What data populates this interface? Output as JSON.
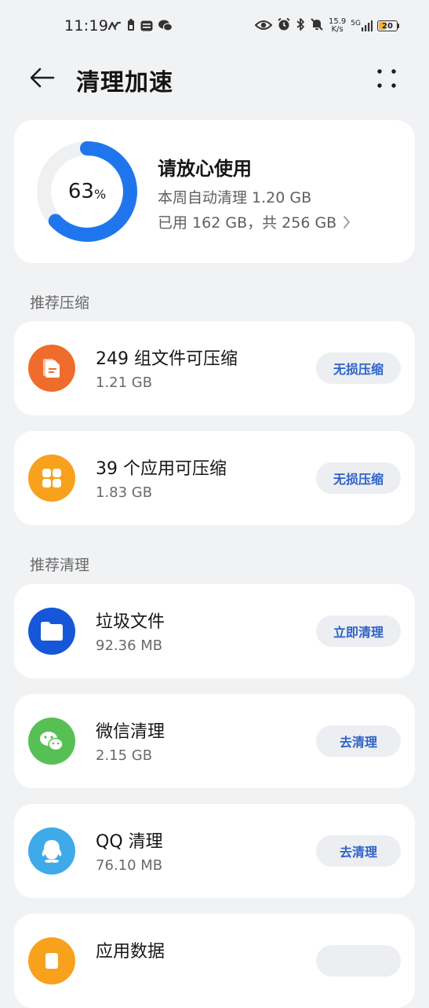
{
  "status_bar": {
    "time": "11:19",
    "net_speed_value": "15.9",
    "net_speed_unit": "K/s",
    "signal": "5G",
    "battery": "20",
    "left_icons": [
      "vpn-icon",
      "battery-saver-icon",
      "message-icon",
      "wechat-icon"
    ],
    "right_icons": [
      "eye-comfort-icon",
      "alarm-icon",
      "bluetooth-icon",
      "mute-icon"
    ]
  },
  "header": {
    "title": "清理加速"
  },
  "summary": {
    "percent": "63",
    "percent_unit": "%",
    "used_fraction": 0.63,
    "status": "请放心使用",
    "weekly_clean": "本周自动清理 1.20 GB",
    "storage": "已用 162 GB，共 256 GB"
  },
  "sections": {
    "compress_label": "推荐压缩",
    "clean_label": "推荐清理"
  },
  "compress_items": [
    {
      "title": "249 组文件可压缩",
      "size": "1.21 GB",
      "action": "无损压缩",
      "icon": "document-icon",
      "color": "#f06c2c"
    },
    {
      "title": "39 个应用可压缩",
      "size": "1.83 GB",
      "action": "无损压缩",
      "icon": "apps-icon",
      "color": "#f7a11d"
    }
  ],
  "clean_items": [
    {
      "title": "垃圾文件",
      "size": "92.36 MB",
      "action": "立即清理",
      "icon": "folder-icon",
      "color": "#1557d8"
    },
    {
      "title": "微信清理",
      "size": "2.15 GB",
      "action": "去清理",
      "icon": "wechat-icon",
      "color": "#56c055"
    },
    {
      "title": "QQ 清理",
      "size": "76.10 MB",
      "action": "去清理",
      "icon": "qq-icon",
      "color": "#3faaea"
    },
    {
      "title": "应用数据",
      "size": "",
      "action": "",
      "icon": "app-data-icon",
      "color": "#f7a11d"
    }
  ]
}
